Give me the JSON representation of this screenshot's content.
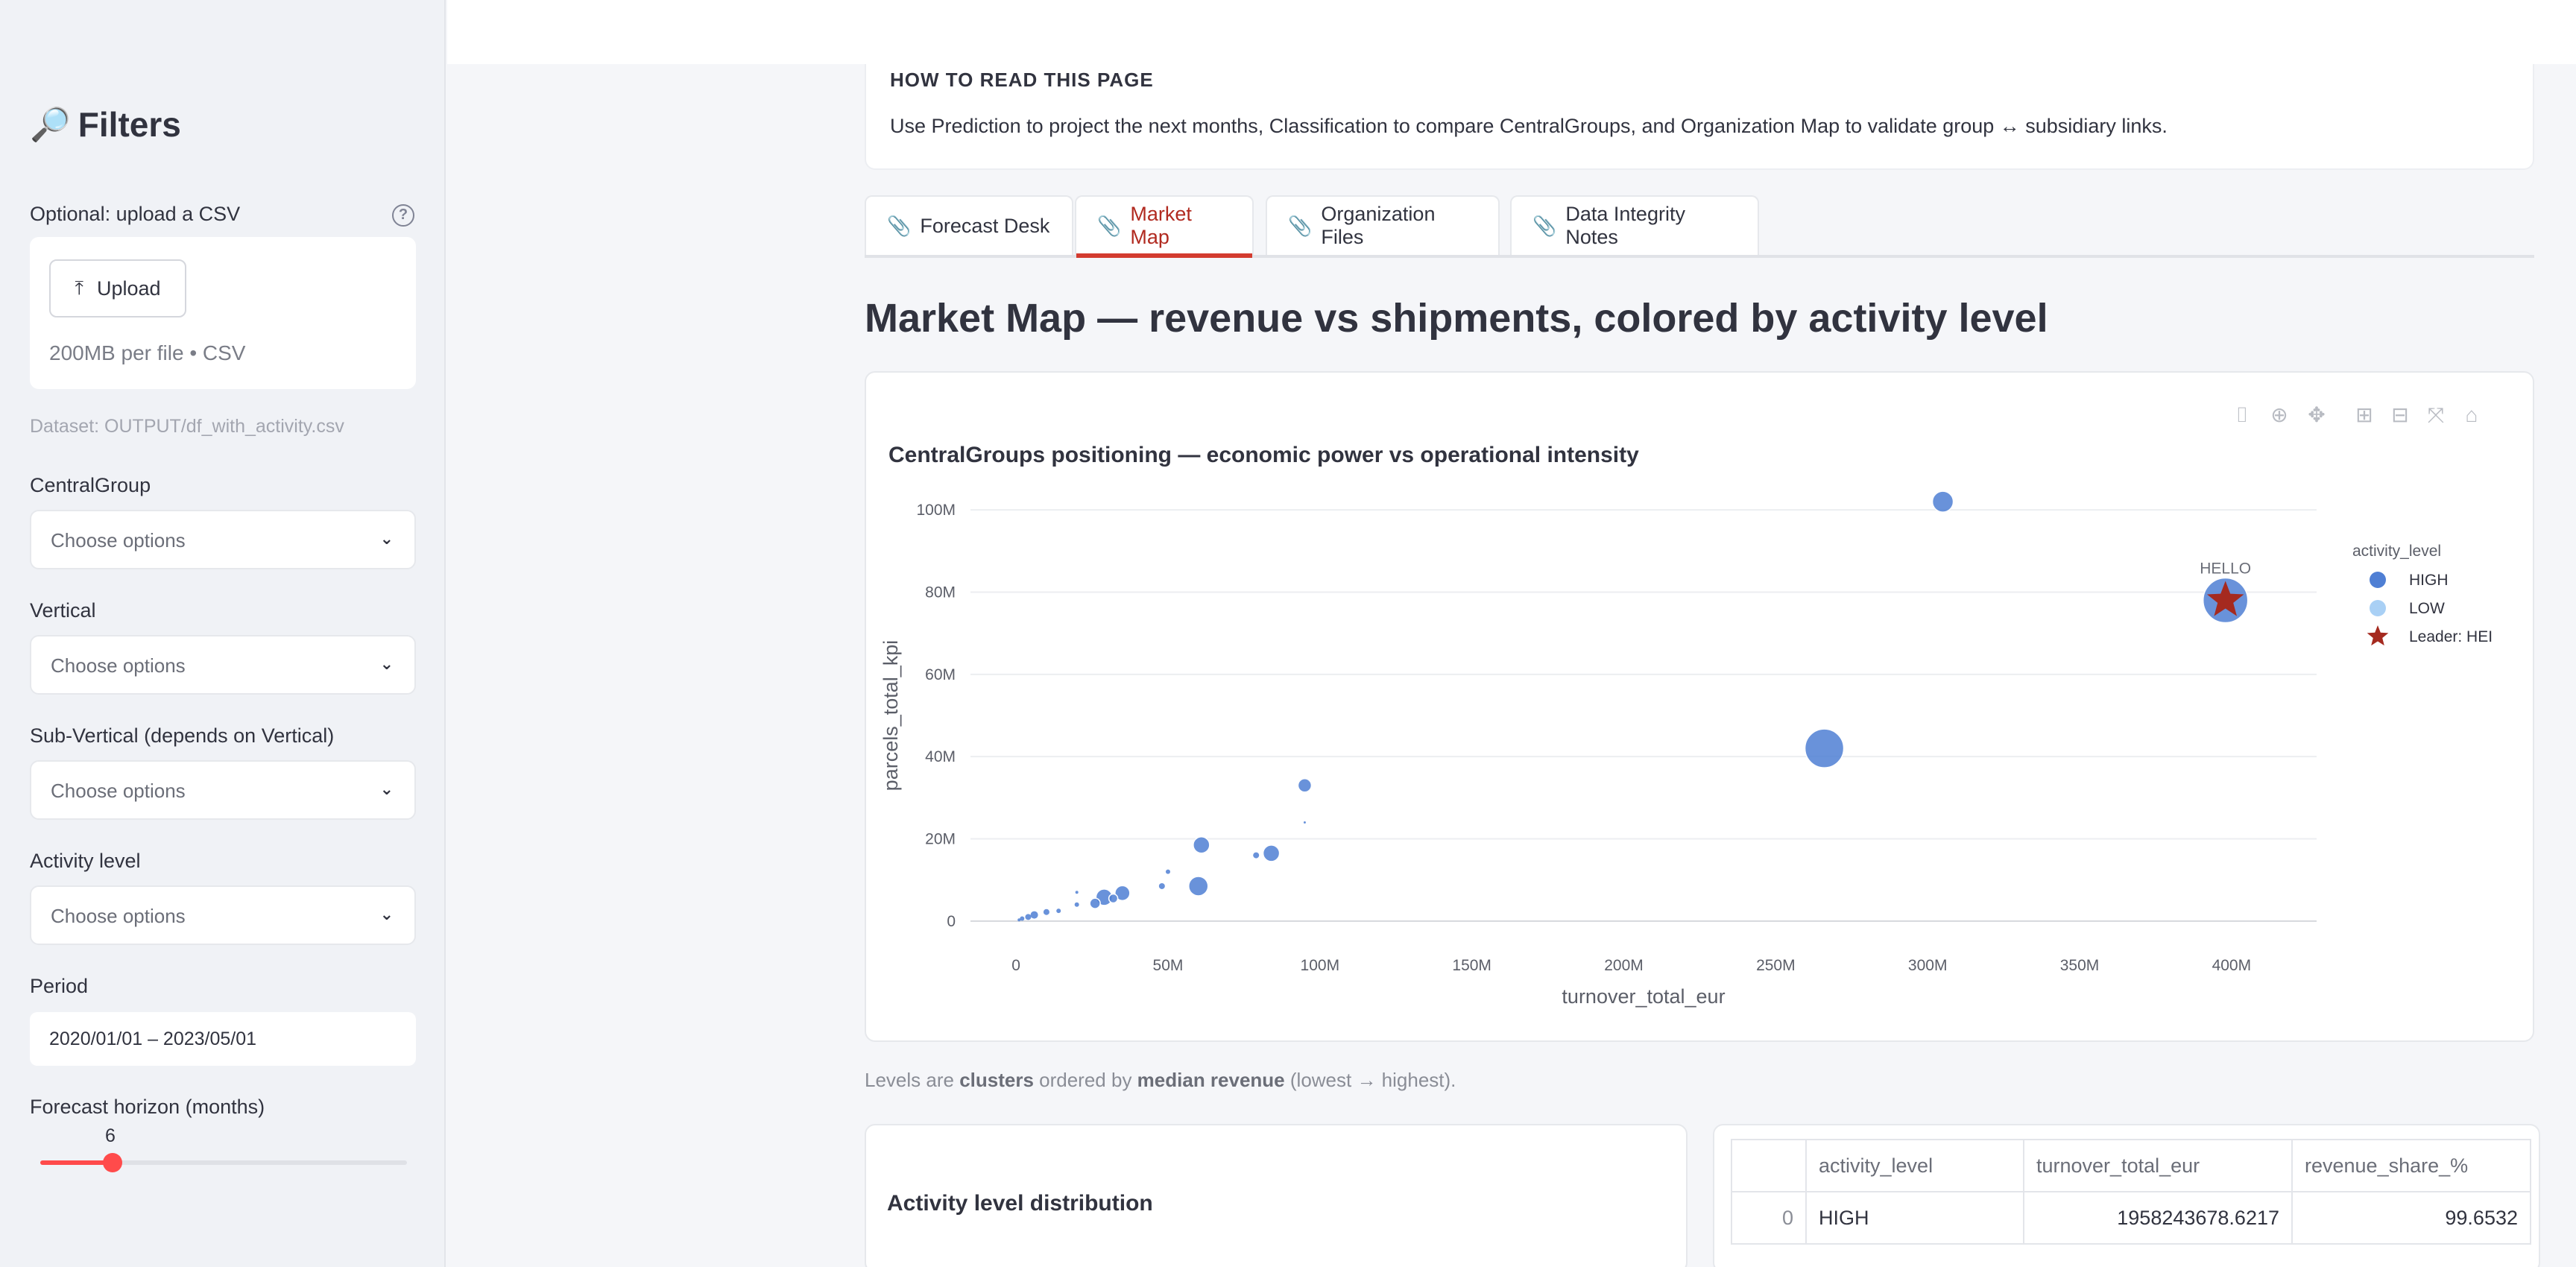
{
  "sidebar": {
    "title": "Filters",
    "title_icon": "magnifier-icon",
    "upload": {
      "label": "Optional: upload a CSV",
      "button_label": "Upload",
      "hint": "200MB per file • CSV"
    },
    "dataset_text": "Dataset: OUTPUT/df_with_activity.csv",
    "filters": [
      {
        "label": "CentralGroup",
        "placeholder": "Choose options"
      },
      {
        "label": "Vertical",
        "placeholder": "Choose options"
      },
      {
        "label": "Sub-Vertical (depends on Vertical)",
        "placeholder": "Choose options"
      },
      {
        "label": "Activity level",
        "placeholder": "Choose options"
      }
    ],
    "period": {
      "label": "Period",
      "value": "2020/01/01 – 2023/05/01"
    },
    "horizon": {
      "label": "Forecast horizon (months)",
      "value": "6"
    }
  },
  "howto": {
    "title": "HOW TO READ THIS PAGE",
    "text": "Use Prediction to project the next months, Classification to compare CentralGroups, and Organization Map to validate group ↔ subsidiary links."
  },
  "tabs": [
    {
      "label": "Forecast Desk",
      "active": false
    },
    {
      "label": "Market Map",
      "active": true
    },
    {
      "label": "Organization Files",
      "active": false
    },
    {
      "label": "Data Integrity Notes",
      "active": false
    }
  ],
  "section_title": "Market Map — revenue vs shipments, colored by activity level",
  "chart_data": {
    "type": "scatter",
    "title": "CentralGroups positioning — economic power vs operational intensity",
    "xlabel": "turnover_total_eur",
    "ylabel": "parcels_total_kpi",
    "xlim": [
      -15000000,
      428000000
    ],
    "ylim": [
      -8000000,
      108000000
    ],
    "x_ticks": [
      "0",
      "50M",
      "100M",
      "150M",
      "200M",
      "250M",
      "300M",
      "350M",
      "400M"
    ],
    "x_tick_values": [
      0,
      50000000,
      100000000,
      150000000,
      200000000,
      250000000,
      300000000,
      350000000,
      400000000
    ],
    "y_ticks": [
      "0",
      "20M",
      "40M",
      "60M",
      "80M",
      "100M"
    ],
    "y_tick_values": [
      0,
      20000000,
      40000000,
      60000000,
      80000000,
      100000000
    ],
    "grid": true,
    "legend_title": "activity_level",
    "legend_position": "top-right",
    "legend": [
      {
        "name": "HIGH",
        "symbol": "circle",
        "color": "#4f7fd4"
      },
      {
        "name": "LOW",
        "symbol": "circle",
        "color": "#a9d0f5"
      },
      {
        "name": "Leader: HEI",
        "symbol": "star",
        "color": "#a52a1f"
      }
    ],
    "series": [
      {
        "name": "HIGH",
        "color": "#4f7fd4",
        "points": [
          {
            "x": 305000000,
            "y": 102000000,
            "r": 14
          },
          {
            "x": 266000000,
            "y": 42000000,
            "r": 26
          },
          {
            "x": 398000000,
            "y": 78000000,
            "r": 30
          },
          {
            "x": 95000000,
            "y": 33000000,
            "r": 9
          },
          {
            "x": 61000000,
            "y": 18500000,
            "r": 11
          },
          {
            "x": 84000000,
            "y": 16500000,
            "r": 11
          },
          {
            "x": 60000000,
            "y": 8500000,
            "r": 13
          },
          {
            "x": 35000000,
            "y": 6800000,
            "r": 10
          },
          {
            "x": 29000000,
            "y": 5800000,
            "r": 11
          },
          {
            "x": 26000000,
            "y": 4300000,
            "r": 7
          },
          {
            "x": 32000000,
            "y": 5500000,
            "r": 6
          },
          {
            "x": 50000000,
            "y": 12000000,
            "r": 3
          },
          {
            "x": 48000000,
            "y": 8500000,
            "r": 4
          },
          {
            "x": 79000000,
            "y": 16000000,
            "r": 4
          },
          {
            "x": 20000000,
            "y": 4000000,
            "r": 3
          },
          {
            "x": 20000000,
            "y": 7000000,
            "r": 2
          },
          {
            "x": 14000000,
            "y": 2500000,
            "r": 3
          },
          {
            "x": 10000000,
            "y": 2200000,
            "r": 4
          },
          {
            "x": 6000000,
            "y": 1500000,
            "r": 5
          },
          {
            "x": 4000000,
            "y": 1000000,
            "r": 4
          },
          {
            "x": 2000000,
            "y": 600000,
            "r": 3
          },
          {
            "x": 1000000,
            "y": 300000,
            "r": 2
          },
          {
            "x": 95000000,
            "y": 24000000,
            "r": 1.5
          }
        ]
      },
      {
        "name": "Leader: HEI",
        "color": "#a52a1f",
        "symbol": "star",
        "points": [
          {
            "x": 398000000,
            "y": 78000000
          }
        ]
      }
    ],
    "annotations": [
      {
        "text": "HELLO",
        "x": 398000000,
        "y": 78000000
      }
    ]
  },
  "caption": {
    "prefix": "Levels are ",
    "bold1": "clusters",
    "mid": " ordered by ",
    "bold2": "median revenue",
    "suffix": " (lowest → highest)."
  },
  "distribution": {
    "title": "Activity level distribution"
  },
  "table": {
    "columns": [
      "",
      "activity_level",
      "turnover_total_eur",
      "revenue_share_%"
    ],
    "rows": [
      [
        "0",
        "HIGH",
        "1958243678.6217",
        "99.6532"
      ]
    ]
  },
  "modebar_icons": [
    "camera-icon",
    "zoom-icon",
    "pan-icon",
    "zoom-in-icon",
    "zoom-out-icon",
    "autoscale-icon",
    "home-icon"
  ]
}
